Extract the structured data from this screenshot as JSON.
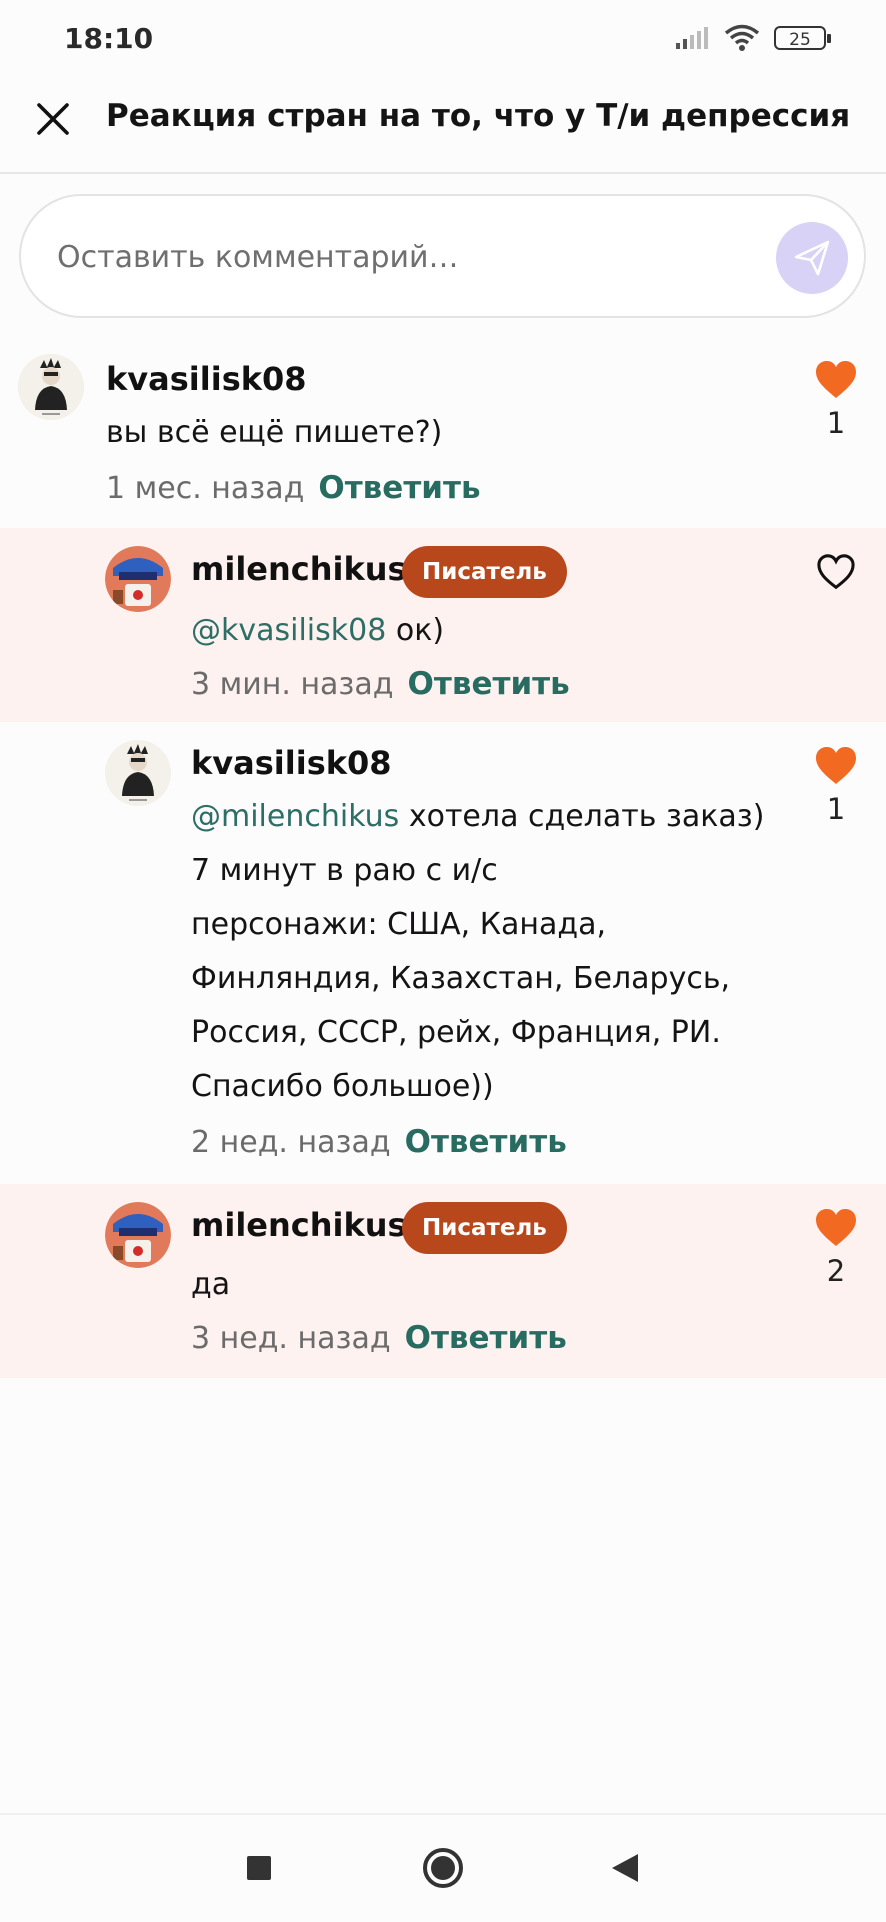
{
  "status": {
    "time": "18:10",
    "battery": "25"
  },
  "header": {
    "title": "Реакция стран на то, что у Т/и депрессия"
  },
  "comment_input": {
    "placeholder": "Оставить комментарий…"
  },
  "comments": [
    {
      "username": "kvasilisk08",
      "badge": "",
      "mention": "",
      "text": "вы всё ещё пишете?)",
      "time": "1 мес. назад",
      "reply": "Ответить",
      "liked": true,
      "likes": "1"
    },
    {
      "username": "milenchikus",
      "badge": "Писатель",
      "mention": "@kvasilisk08",
      "text": " ок)",
      "time": "3 мин. назад",
      "reply": "Ответить",
      "liked": false,
      "likes": ""
    },
    {
      "username": "kvasilisk08",
      "badge": "",
      "mention": "@milenchikus",
      "text": " хотела сделать заказ)",
      "lines": [
        "7 минут в раю с и/с",
        "персонажи: США, Канада,",
        "Финляндия, Казахстан, Беларусь,",
        "Россия, СССР, рейх, Франция, РИ.",
        "Спасибо большое))"
      ],
      "time": "2 нед. назад",
      "reply": "Ответить",
      "liked": true,
      "likes": "1"
    },
    {
      "username": "milenchikus",
      "badge": "Писатель",
      "mention": "",
      "text": "да",
      "time": "3 нед. назад",
      "reply": "Ответить",
      "liked": true,
      "likes": "2"
    }
  ],
  "colors": {
    "accent": "#286b60",
    "badge": "#b8471c",
    "heart": "#f26a21",
    "highlight": "#fdf2ef"
  },
  "icons": [
    "close-icon",
    "send-icon",
    "heart-filled-icon",
    "heart-outline-icon",
    "nav-square-icon",
    "nav-home-icon",
    "nav-back-icon"
  ]
}
